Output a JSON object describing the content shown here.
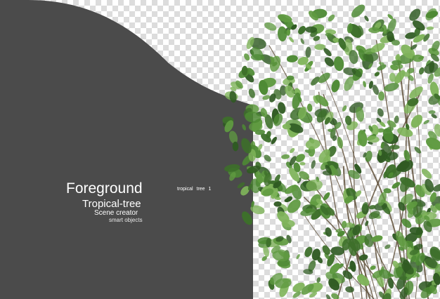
{
  "texts": {
    "title": "Foreground",
    "subtitle": "Tropical-tree",
    "line3": "Scene creator",
    "line4": "smart objects",
    "tag": "tropical  tree 1"
  },
  "colors": {
    "backdrop": "#4b4b4b",
    "checker_light": "#ffffff",
    "checker_dark": "#dcdcdc",
    "leaf_dark": "#2f5a22",
    "leaf_mid": "#4e8a34",
    "leaf_light": "#7fb45a"
  }
}
